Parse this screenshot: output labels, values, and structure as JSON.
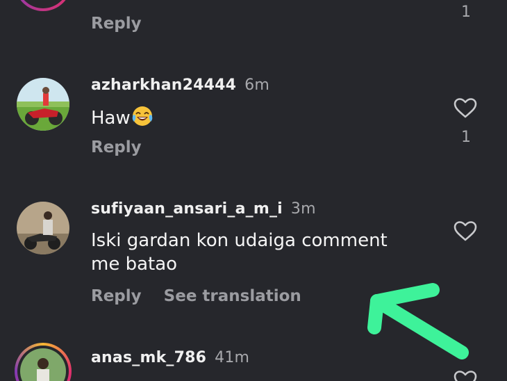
{
  "comments": [
    {
      "username": "",
      "time": "",
      "text": "",
      "reply_label": "Reply",
      "likes": "1"
    },
    {
      "username": "azharkhan24444",
      "time": "6m",
      "text": "Haw",
      "emoji": "face-with-tears-of-joy-icon",
      "reply_label": "Reply",
      "likes": "1"
    },
    {
      "username": "sufiyaan_ansari_a_m_i",
      "time": "3m",
      "text": "Iski gardan kon udaiga comment me batao",
      "reply_label": "Reply",
      "translation_label": "See translation"
    },
    {
      "username": "anas_mk_786",
      "time": "41m"
    }
  ],
  "annotation": {
    "arrow_color": "#3ef29a"
  }
}
